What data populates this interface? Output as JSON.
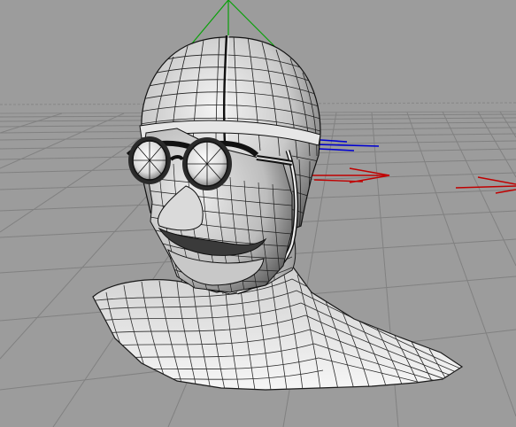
{
  "viewport": {
    "background": "#9c9c9c",
    "grid_color": "#7e7e7e",
    "horizon_color": "#8f8f8f"
  },
  "axes": {
    "y_axis_color": "#0aa00a",
    "x_axis_color": "#c00000",
    "z_axis_color": "#0000d0"
  },
  "model": {
    "kind": "wireframe-head-bust-with-goggles",
    "shading": "gouraud-with-wireframe",
    "surface_light": "#f2f2f2",
    "surface_dark": "#404040",
    "wire_color": "#111111"
  }
}
